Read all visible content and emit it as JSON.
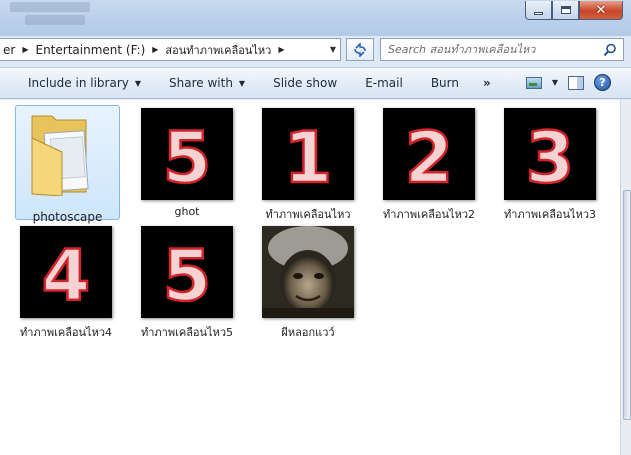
{
  "address": {
    "crumbs": [
      "er",
      "Entertainment (F:)",
      "สอนทำภาพเคลือนไหว"
    ]
  },
  "search": {
    "placeholder": "Search สอนทำภาพเคลือนไหว"
  },
  "toolbar": {
    "include_library": "Include in library",
    "share_with": "Share with",
    "slide_show": "Slide show",
    "email": "E-mail",
    "burn": "Burn",
    "more": "»",
    "help": "?"
  },
  "items": [
    {
      "name": "photoscape",
      "type": "folder",
      "selected": true
    },
    {
      "name": "ghot",
      "type": "image",
      "digit": "5"
    },
    {
      "name": "ทำภาพเคลือนไหว",
      "type": "image",
      "digit": "1"
    },
    {
      "name": "ทำภาพเคลือนไหว2",
      "type": "image",
      "digit": "2"
    },
    {
      "name": "ทำภาพเคลือนไหว3",
      "type": "image",
      "digit": "3"
    },
    {
      "name": "ทำภาพเคลือนไหว4",
      "type": "image",
      "digit": "4"
    },
    {
      "name": "ทำภาพเคลือนไหว5",
      "type": "image",
      "digit": "5"
    },
    {
      "name": "ผีหลอกแวว์",
      "type": "image",
      "digit": ""
    }
  ],
  "colors": {
    "digit_fill": "#f6d3d3",
    "digit_stroke": "#d2222a",
    "selection": "#cde6fb"
  }
}
